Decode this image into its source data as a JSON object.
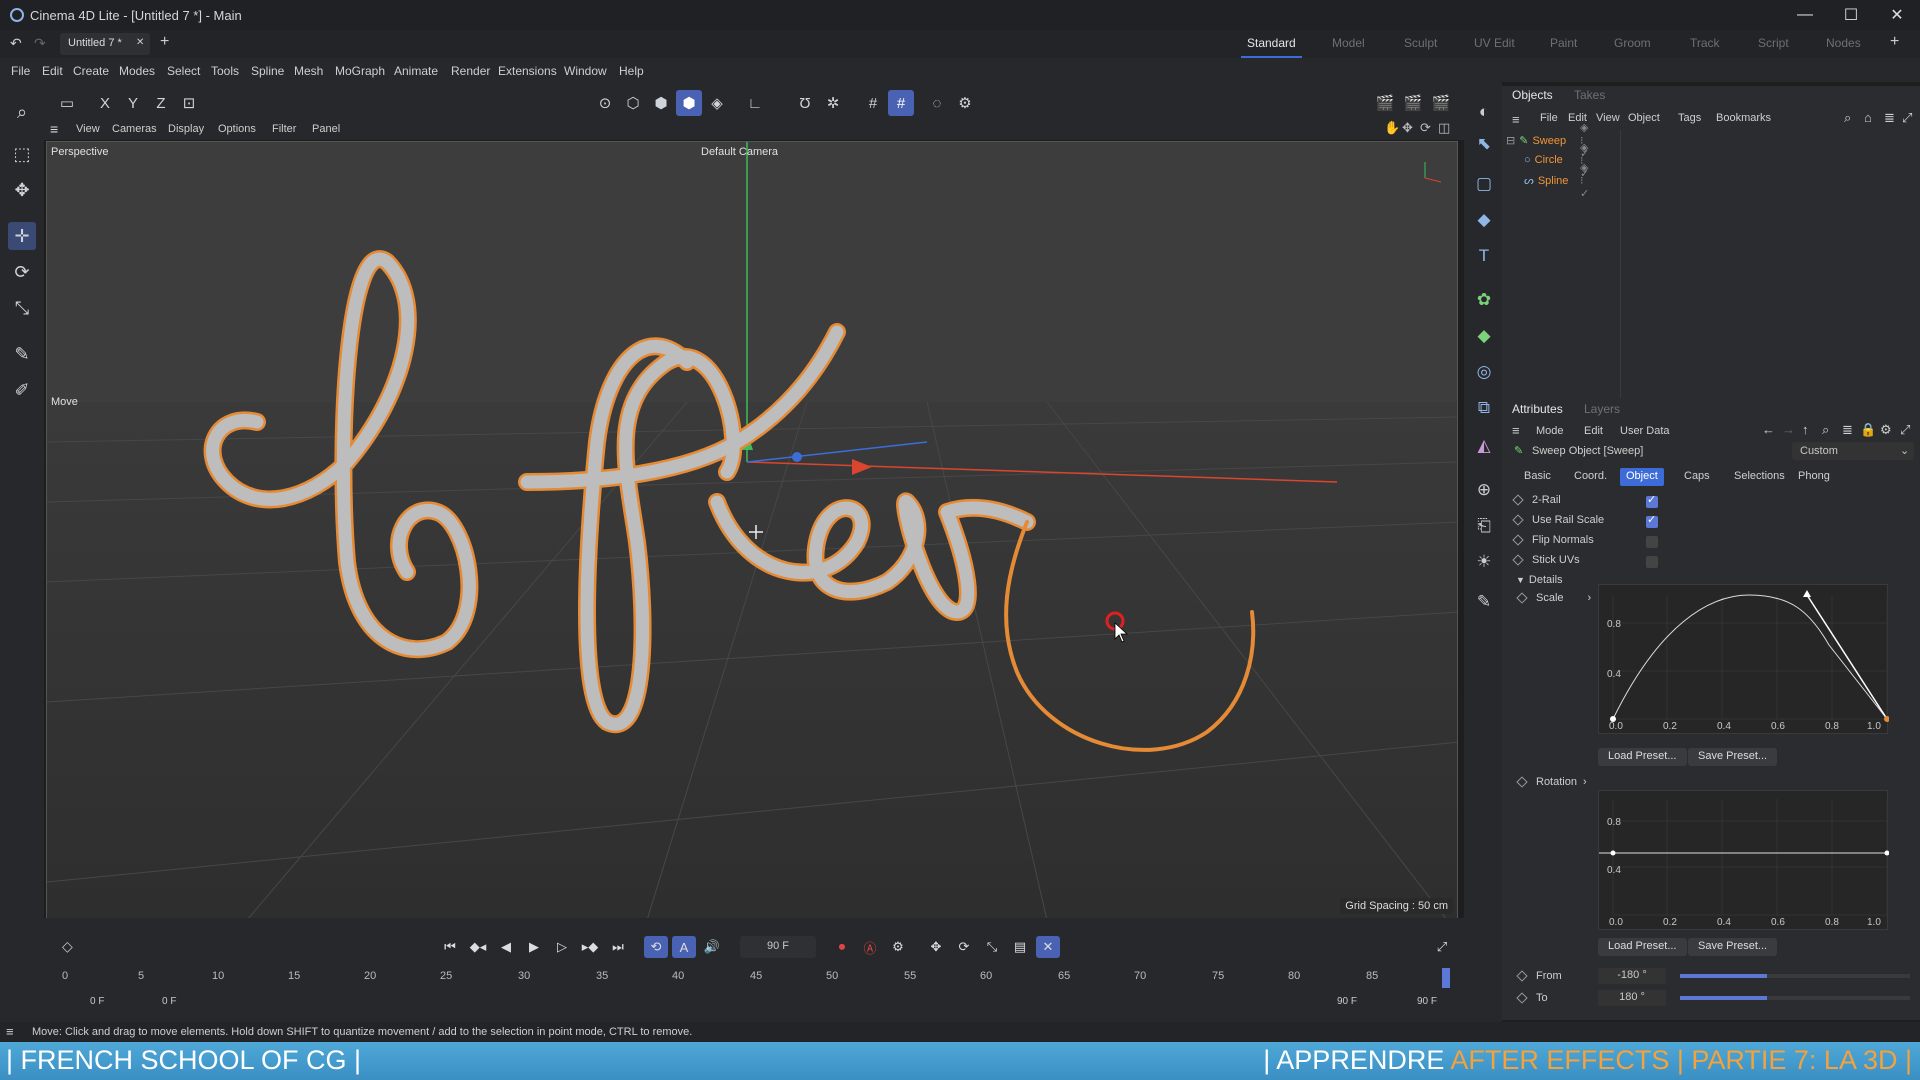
{
  "window": {
    "title": "Cinema 4D Lite - [Untitled 7 *] - Main",
    "minimize": "—",
    "maximize": "☐",
    "close": "✕"
  },
  "tabs": {
    "document": "Untitled 7 *",
    "layouts": [
      "Standard",
      "Model",
      "Sculpt",
      "UV Edit",
      "Paint",
      "Groom",
      "Track",
      "Script",
      "Nodes"
    ]
  },
  "menu": [
    "File",
    "Edit",
    "Create",
    "Modes",
    "Select",
    "Tools",
    "Spline",
    "Mesh",
    "MoGraph",
    "Animate",
    "Render",
    "Extensions",
    "Window",
    "Help"
  ],
  "axes": {
    "x": "X",
    "y": "Y",
    "z": "Z"
  },
  "viewport_menu": [
    "View",
    "Cameras",
    "Display",
    "Options",
    "Filter",
    "Panel"
  ],
  "viewport": {
    "name": "Perspective",
    "camera": "Default Camera",
    "tool": "Move",
    "grid_spacing": "Grid Spacing : 50 cm"
  },
  "objects_panel": {
    "tabs": [
      "Objects",
      "Takes"
    ],
    "menu": [
      "File",
      "Edit",
      "View",
      "Object",
      "Tags",
      "Bookmarks"
    ],
    "items": [
      {
        "name": "Sweep"
      },
      {
        "name": "Circle"
      },
      {
        "name": "Spline"
      }
    ]
  },
  "attributes_panel": {
    "tabs": [
      "Attributes",
      "Layers"
    ],
    "menu": [
      "Mode",
      "Edit",
      "User Data"
    ],
    "object_title": "Sweep Object [Sweep]",
    "preset": "Custom",
    "sub_tabs": [
      "Basic",
      "Coord.",
      "Object",
      "Caps",
      "Selections",
      "Phong"
    ],
    "params": [
      {
        "label": "2-Rail",
        "checked": true
      },
      {
        "label": "Use Rail Scale",
        "checked": true
      },
      {
        "label": "Flip Normals",
        "checked": false
      },
      {
        "label": "Stick UVs",
        "checked": false
      }
    ],
    "details_label": "Details",
    "scale_label": "Scale",
    "rotation_label": "Rotation",
    "graph_y_labels": [
      "0.8",
      "0.4"
    ],
    "graph_x_labels": [
      "0.0",
      "0.2",
      "0.4",
      "0.6",
      "0.8",
      "1.0"
    ],
    "load_preset": "Load Preset...",
    "save_preset": "Save Preset...",
    "from_label": "From",
    "from_value": "-180 °",
    "to_label": "To",
    "to_value": "180 °"
  },
  "timeline": {
    "current_frame": "90 F",
    "start": "0 F",
    "start_min": "0 F",
    "end": "90 F",
    "end_max": "90 F",
    "ticks": [
      "0",
      "5",
      "10",
      "15",
      "20",
      "25",
      "30",
      "35",
      "40",
      "45",
      "50",
      "55",
      "60",
      "65",
      "70",
      "75",
      "80",
      "85"
    ]
  },
  "status": "Move: Click and drag to move elements. Hold down SHIFT to quantize movement / add to the selection in point mode, CTRL to remove.",
  "banner": {
    "left": "| FRENCH SCHOOL OF CG |",
    "right_a": "| APPRENDRE ",
    "right_b": "AFTER EFFECTS",
    "right_c": " | PARTIE 7: LA 3D |"
  },
  "colors": {
    "accent": "#3d6bd8",
    "object_orange": "#f0953a",
    "banner_highlight": "#f3a23c"
  }
}
